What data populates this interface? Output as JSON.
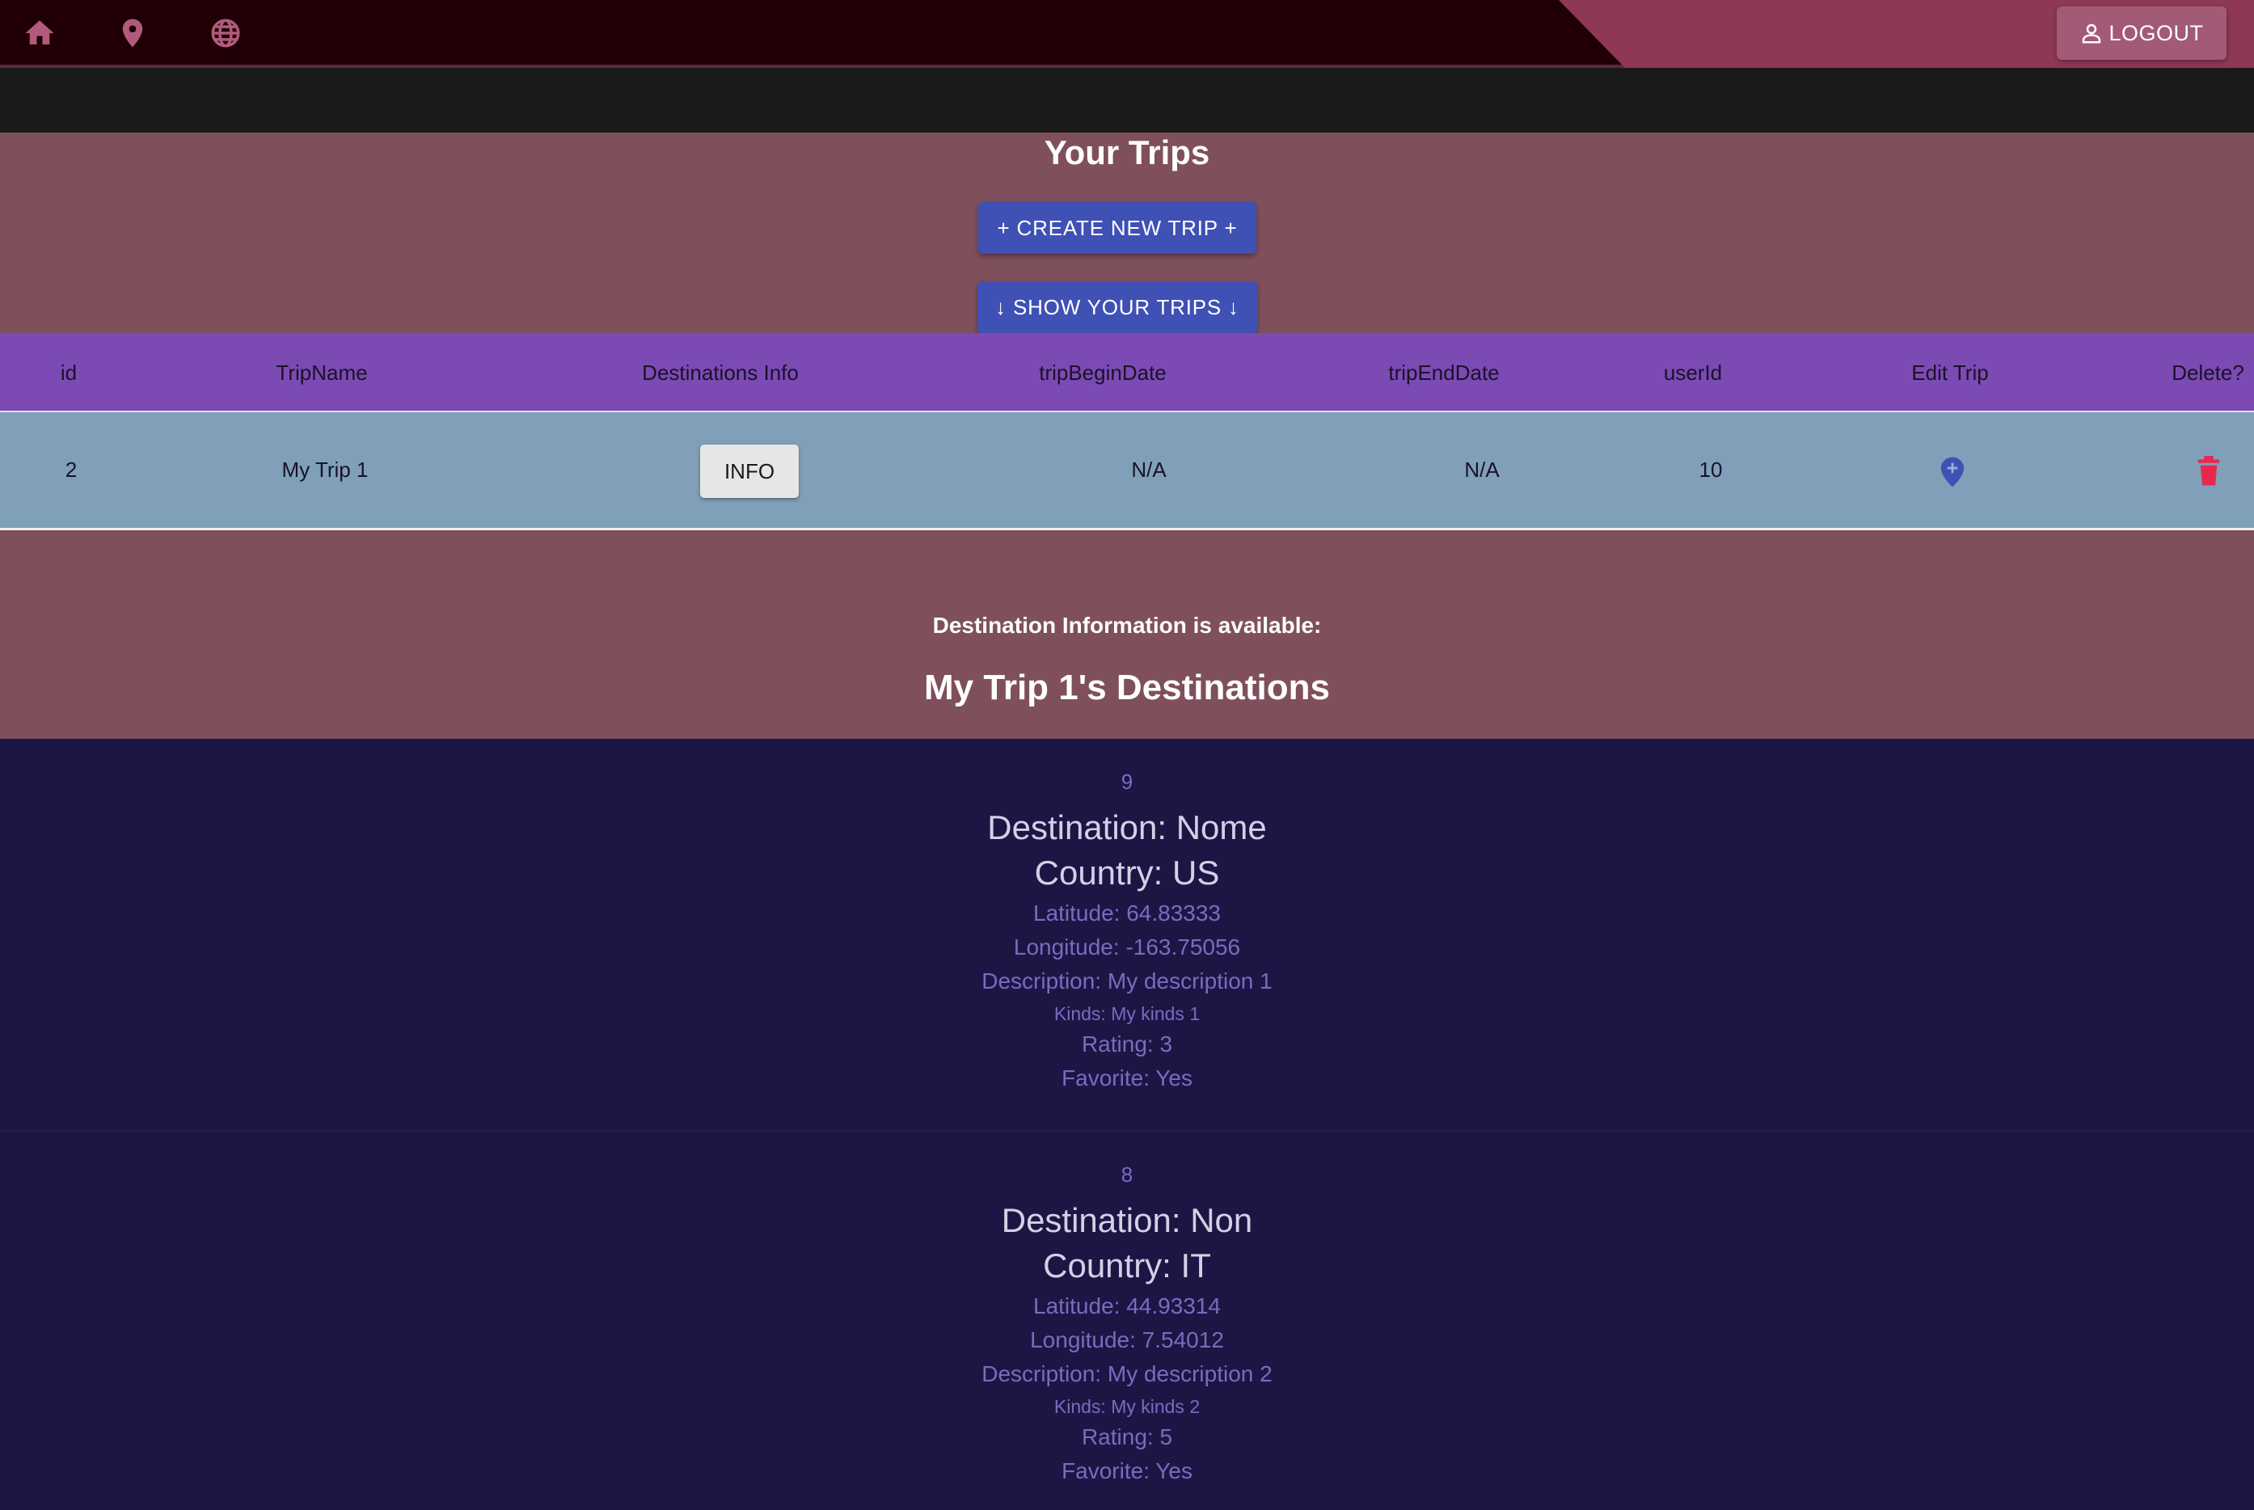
{
  "nav": {
    "icons": [
      "home-icon",
      "location-pin-icon",
      "globe-icon"
    ],
    "logout_label": "LOGOUT"
  },
  "trips": {
    "title": "Your Trips",
    "create_label": "+ CREATE NEW TRIP +",
    "show_label": "↓ SHOW YOUR TRIPS ↓"
  },
  "table": {
    "headers": [
      "id",
      "TripName",
      "Destinations Info",
      "tripBeginDate",
      "tripEndDate",
      "userId",
      "Edit Trip",
      "Delete?"
    ],
    "rows": [
      {
        "id": "2",
        "name": "My Trip 1",
        "info_label": "INFO",
        "begin": "N/A",
        "end": "N/A",
        "user": "10"
      }
    ]
  },
  "destinations": {
    "available_text": "Destination Information is available:",
    "title": "My Trip 1's Destinations",
    "items": [
      {
        "id": "9",
        "destination": "Destination: Nome",
        "country": "Country: US",
        "latitude": "Latitude: 64.83333",
        "longitude": "Longitude: -163.75056",
        "description": "Description: My description 1",
        "kinds": "Kinds: My kinds 1",
        "rating": "Rating: 3",
        "favorite": "Favorite: Yes"
      },
      {
        "id": "8",
        "destination": "Destination: Non",
        "country": "Country: IT",
        "latitude": "Latitude: 44.93314",
        "longitude": "Longitude: 7.54012",
        "description": "Description: My description 2",
        "kinds": "Kinds: My kinds 2",
        "rating": "Rating: 5",
        "favorite": "Favorite: Yes"
      }
    ]
  },
  "colors": {
    "topbar": "#200004",
    "accent": "#8e3855",
    "panel": "#7f505c",
    "table_header": "#7b4ab3",
    "table_row": "#7fa0b8",
    "button": "#3f51b5",
    "dest_bg": "#1d1645",
    "delete": "#e8294f"
  }
}
